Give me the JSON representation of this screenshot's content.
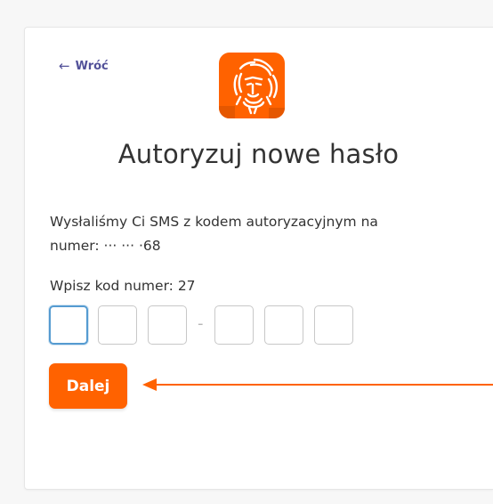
{
  "back": {
    "label": "Wróć",
    "arrow": "←"
  },
  "logo": {
    "name": "ING lion",
    "color": "#ff6200"
  },
  "title": "Autoryzuj nowe hasło",
  "info": {
    "line1": "Wysłaliśmy Ci SMS z kodem autoryzacyjnym na",
    "line2": "numer: ··· ··· ·68"
  },
  "code": {
    "label": "Wpisz kod numer: 27",
    "digits": [
      "",
      "",
      "",
      "",
      "",
      ""
    ],
    "separator": "-"
  },
  "next_button": {
    "label": "Dalej",
    "color": "#ff6200"
  },
  "annotation": {
    "color": "#ff6200"
  }
}
